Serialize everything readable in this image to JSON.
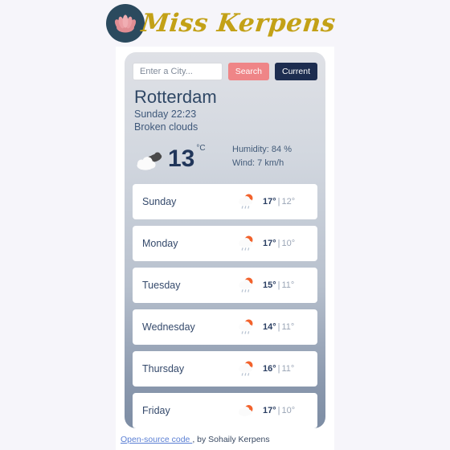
{
  "brand": {
    "wordmark": "Miss Kerpens",
    "logo_icon": "lotus-flower-icon",
    "logo_circle_color": "#2b4a5e",
    "lotus_color": "#e08d93",
    "wordmark_color": "#c3a117"
  },
  "search": {
    "placeholder": "Enter a City...",
    "value": "",
    "search_label": "Search",
    "current_label": "Current",
    "search_color": "#ef8587",
    "current_color": "#1d2d50"
  },
  "current": {
    "city": "Rotterdam",
    "datetime": "Sunday 22:23",
    "description": "Broken clouds",
    "icon": "broken-clouds-icon",
    "temperature": "13",
    "unit": "°C",
    "humidity": "Humidity: 84 %",
    "wind": "Wind: 7 km/h"
  },
  "forecast": {
    "rows": [
      {
        "day": "Sunday",
        "icon": "sun-cloud-rain-icon",
        "high": "17°",
        "sep": "|",
        "low": "12°"
      },
      {
        "day": "Monday",
        "icon": "sun-cloud-rain-icon",
        "high": "17°",
        "sep": "|",
        "low": "10°"
      },
      {
        "day": "Tuesday",
        "icon": "sun-cloud-rain-icon",
        "high": "15°",
        "sep": "|",
        "low": "11°"
      },
      {
        "day": "Wednesday",
        "icon": "sun-cloud-rain-icon",
        "high": "14°",
        "sep": "|",
        "low": "11°"
      },
      {
        "day": "Thursday",
        "icon": "sun-cloud-rain-icon",
        "high": "16°",
        "sep": "|",
        "low": "11°"
      },
      {
        "day": "Friday",
        "icon": "sun-cloud-icon",
        "high": "17°",
        "sep": "|",
        "low": "10°"
      }
    ]
  },
  "footer": {
    "link_label": "Open-source code ",
    "attribution": ", by Sohaily Kerpens"
  }
}
